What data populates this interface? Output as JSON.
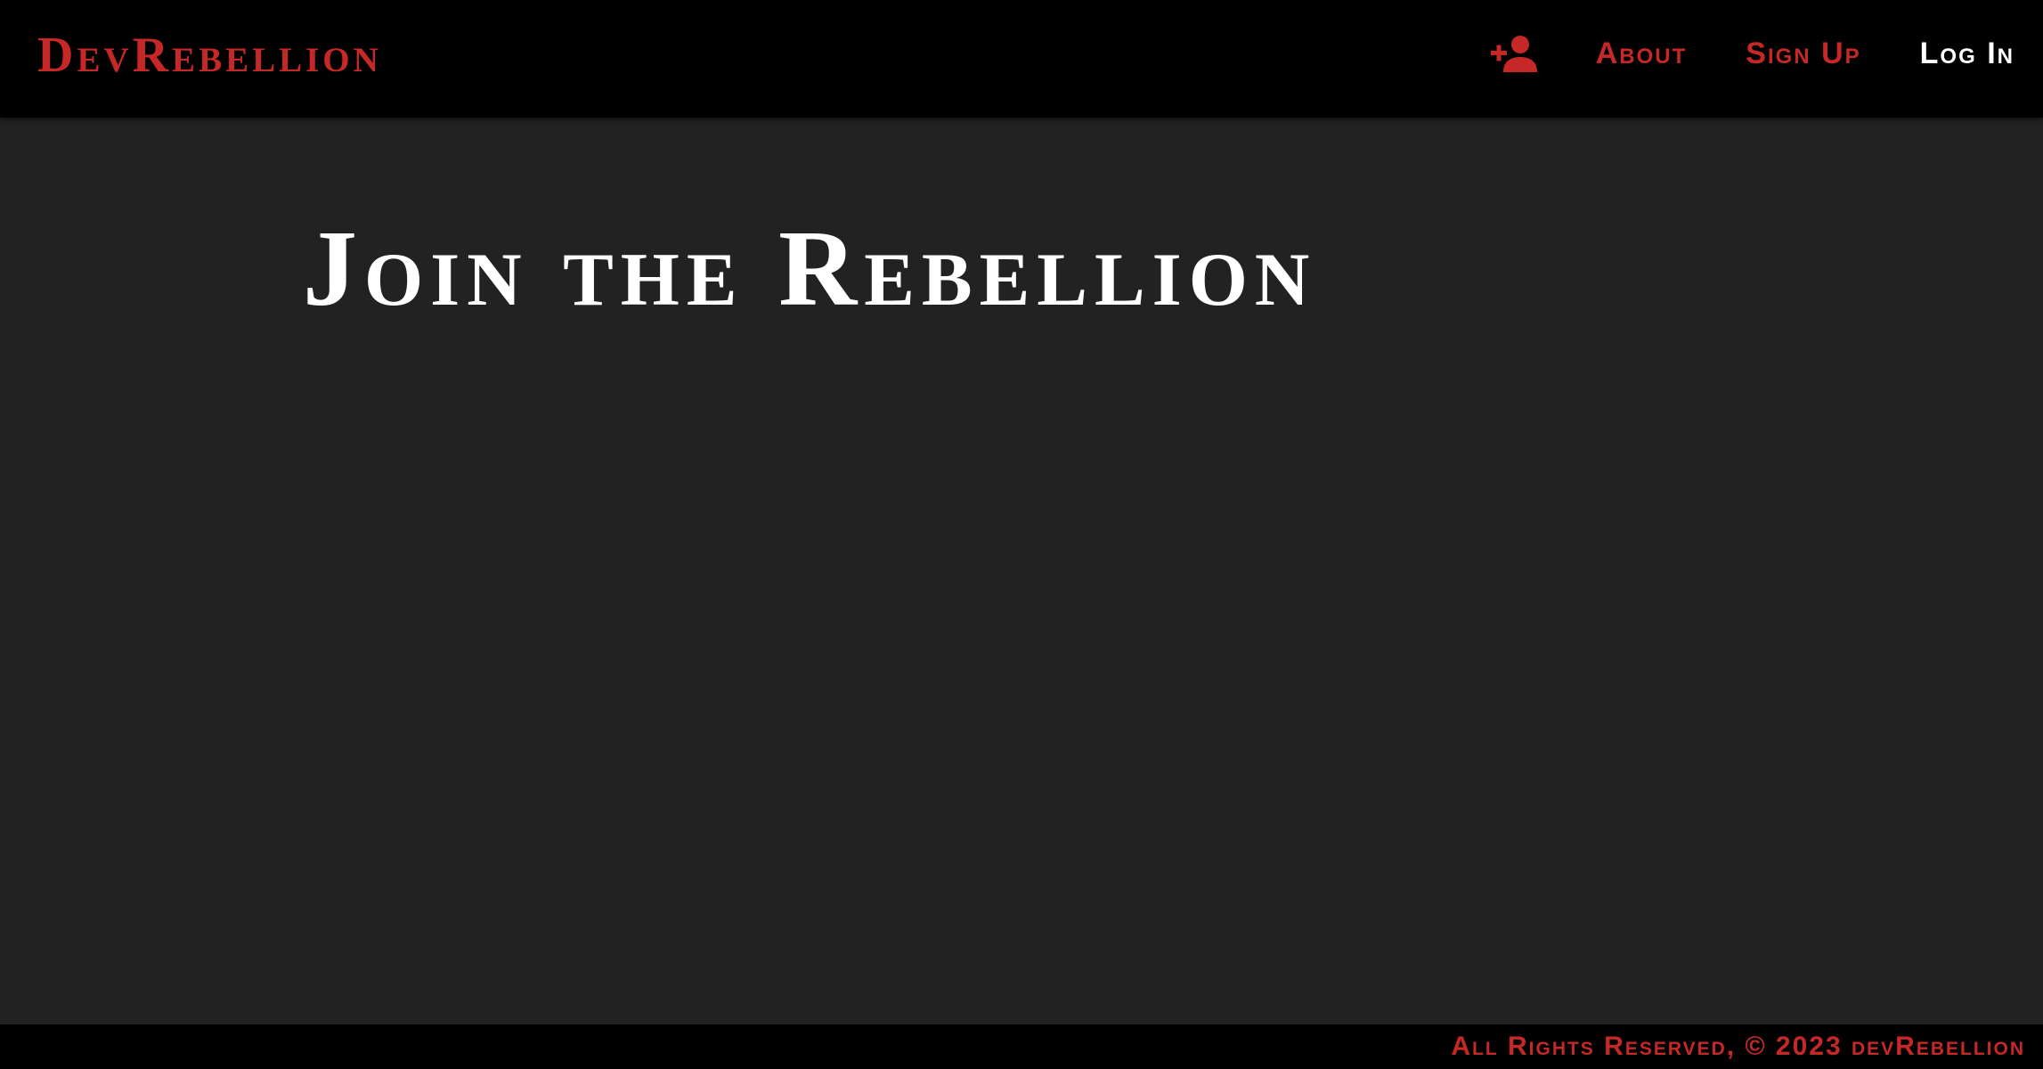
{
  "app": {
    "brand": "DevRebellion"
  },
  "nav": {
    "icon": "add-user-icon",
    "links": [
      {
        "label": "About"
      },
      {
        "label": "Sign Up"
      },
      {
        "label": "Log In"
      }
    ]
  },
  "main": {
    "title": "Join the Rebellion"
  },
  "footer": {
    "text": "All Rights Reserved, © 2023 devRebellion"
  },
  "colors": {
    "accent": "#c62828",
    "navbar_bg": "#000000",
    "page_bg": "#222222",
    "text_light": "#ffffff"
  }
}
